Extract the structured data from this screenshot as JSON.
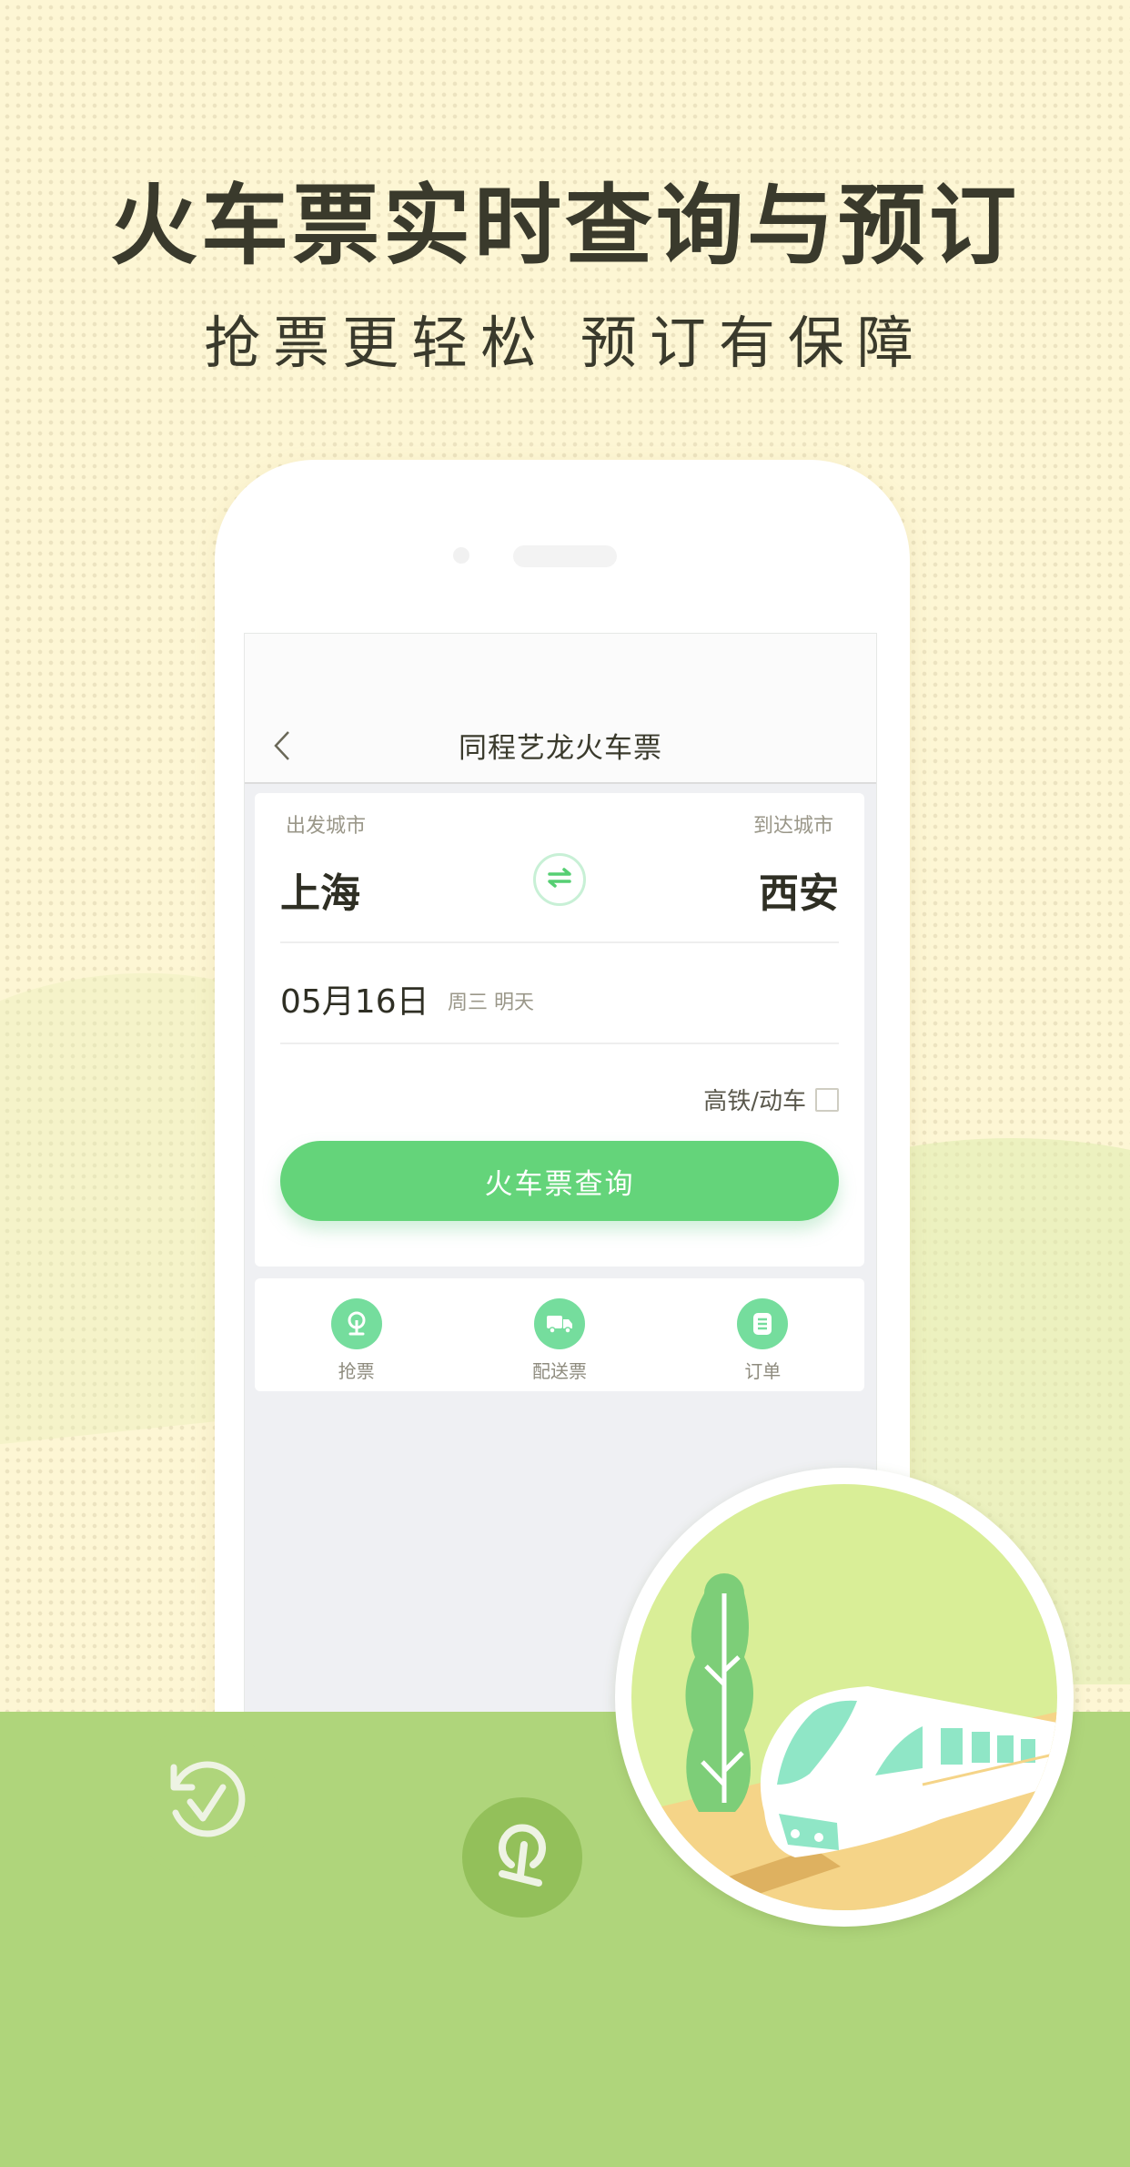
{
  "promo": {
    "headline": "火车票实时查询与预订",
    "subline": "抢票更轻松  预订有保障"
  },
  "app": {
    "nav_title": "同程艺龙火车票",
    "back_icon": "chevron-left-icon"
  },
  "search": {
    "from_label": "出发城市",
    "from_city": "上海",
    "to_label": "到达城市",
    "to_city": "西安",
    "swap_icon": "swap-arrows-icon",
    "date": "05月16日",
    "date_note": "周三 明天",
    "high_speed_label": "高铁/动车",
    "high_speed_checked": false,
    "search_button": "火车票查询"
  },
  "quick_actions": [
    {
      "label": "抢票",
      "icon": "railway-logo-icon"
    },
    {
      "label": "配送票",
      "icon": "delivery-truck-icon"
    },
    {
      "label": "订单",
      "icon": "order-list-icon"
    }
  ],
  "decorations": {
    "history_icon": "refresh-check-icon",
    "station_icon": "railway-logo-icon",
    "illustration": "high-speed-train-illustration"
  },
  "colors": {
    "accent_green": "#64d47a",
    "icon_green": "#75dd9d",
    "ground_green": "#afd57b",
    "background_cream": "#fdf6d4",
    "text_dark": "#3a3a2c"
  }
}
